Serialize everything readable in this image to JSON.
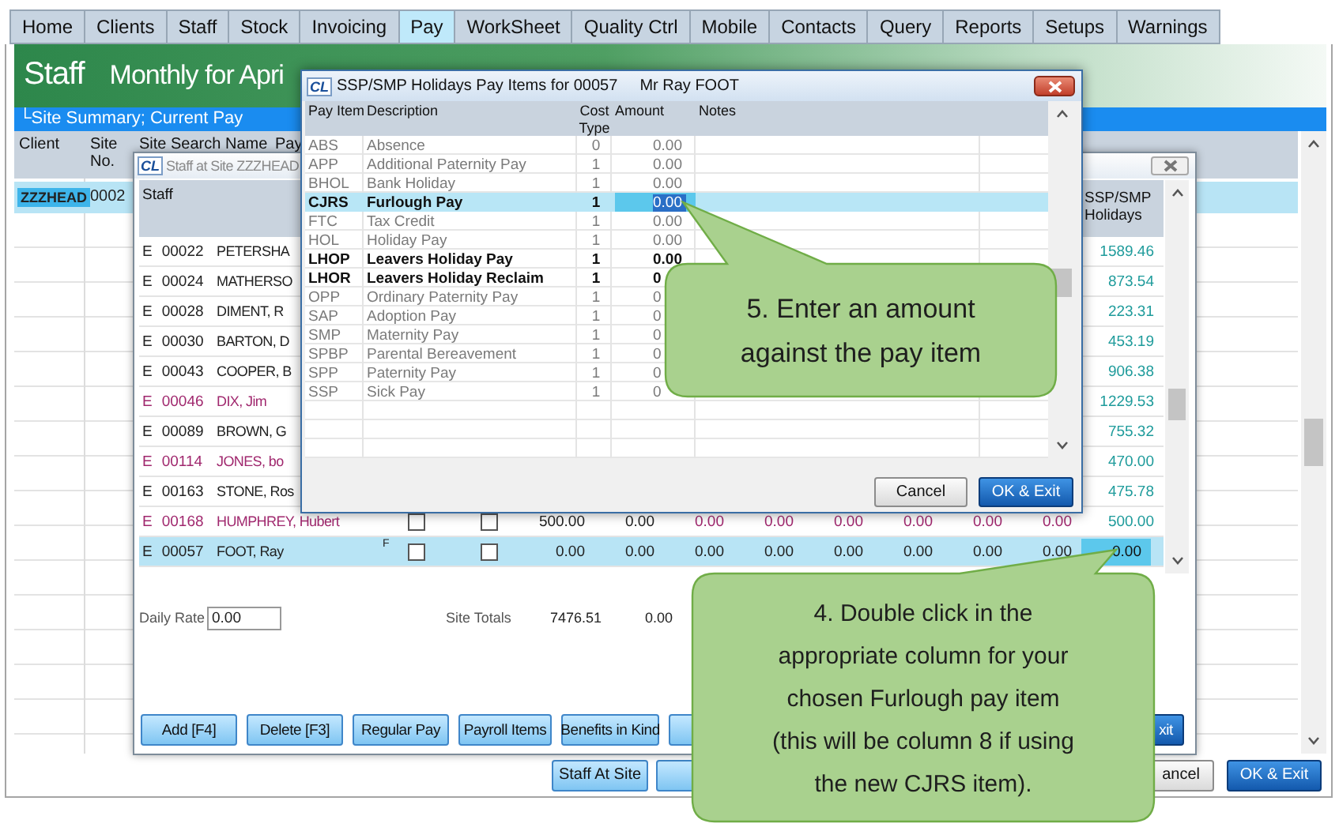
{
  "tabs": [
    {
      "label": "Home",
      "selected": false
    },
    {
      "label": "Clients",
      "selected": false
    },
    {
      "label": "Staff",
      "selected": false
    },
    {
      "label": "Stock",
      "selected": false
    },
    {
      "label": "Invoicing",
      "selected": false
    },
    {
      "label": "Pay",
      "selected": true
    },
    {
      "label": "WorkSheet",
      "selected": false
    },
    {
      "label": "Quality Ctrl",
      "selected": false
    },
    {
      "label": "Mobile",
      "selected": false
    },
    {
      "label": "Contacts",
      "selected": false
    },
    {
      "label": "Query",
      "selected": false
    },
    {
      "label": "Reports",
      "selected": false
    },
    {
      "label": "Setups",
      "selected": false
    },
    {
      "label": "Warnings",
      "selected": false
    }
  ],
  "header": {
    "title": "Staff",
    "subtitle": "Monthly for Apri"
  },
  "breadcrumb": "└Site Summary; Current Pay",
  "main_table": {
    "columns": [
      "Client",
      "Site No.",
      "Site Search Name",
      "Pay"
    ],
    "rows": [
      {
        "client": "ZZZHEAD",
        "site_no": "0002",
        "selected": true
      }
    ]
  },
  "main_buttons": [
    {
      "label": "Staff At Site",
      "kind": "light"
    },
    {
      "kind": "blank"
    },
    {
      "label": "ancel",
      "kind": "plain"
    },
    {
      "label": "OK & Exit",
      "kind": "primary"
    }
  ],
  "staff_window": {
    "logo": "CL",
    "title": "Staff at Site ZZZHEAD",
    "columns": [
      "Staff",
      "SSP/SMP Holidays"
    ],
    "rows": [
      {
        "type": "E",
        "code": "00022",
        "name": "PETERSHA",
        "color": "#222222",
        "holidays": "1589.46",
        "selected": false
      },
      {
        "type": "E",
        "code": "00024",
        "name": "MATHERSO",
        "color": "#222222",
        "holidays": "873.54",
        "selected": false
      },
      {
        "type": "E",
        "code": "00028",
        "name": "DIMENT, R",
        "color": "#222222",
        "holidays": "223.31",
        "selected": false
      },
      {
        "type": "E",
        "code": "00030",
        "name": "BARTON, D",
        "color": "#222222",
        "holidays": "453.19",
        "selected": false
      },
      {
        "type": "E",
        "code": "00043",
        "name": "COOPER, B",
        "color": "#222222",
        "holidays": "906.38",
        "selected": false
      },
      {
        "type": "E",
        "code": "00046",
        "name": "DIX, Jim",
        "color": "#a0286e",
        "holidays": "1229.53",
        "selected": false
      },
      {
        "type": "E",
        "code": "00089",
        "name": "BROWN, G",
        "color": "#222222",
        "holidays": "755.32",
        "selected": false
      },
      {
        "type": "E",
        "code": "00114",
        "name": "JONES, bo",
        "color": "#a0286e",
        "holidays": "470.00",
        "selected": false
      },
      {
        "type": "E",
        "code": "00163",
        "name": "STONE, Ros",
        "color": "#222222",
        "holidays": "475.78",
        "selected": false
      },
      {
        "type": "E",
        "code": "00168",
        "name": "HUMPHREY, Hubert",
        "color": "#a0286e",
        "holidays": "500.00",
        "selected": false,
        "checks": [
          false,
          false
        ],
        "values": [
          {
            "text": "500.00",
            "color": "#222222"
          },
          {
            "text": "0.00",
            "color": "#222222"
          },
          {
            "text": "0.00",
            "color": "#a0286e"
          },
          {
            "text": "0.00",
            "color": "#a0286e"
          },
          {
            "text": "0.00",
            "color": "#a0286e"
          },
          {
            "text": "0.00",
            "color": "#a0286e"
          },
          {
            "text": "0.00",
            "color": "#a0286e"
          },
          {
            "text": "0.00",
            "color": "#a0286e"
          }
        ]
      },
      {
        "type": "E",
        "code": "00057",
        "name": "FOOT, Ray",
        "color": "#222222",
        "holidays": "0.00",
        "selected": true,
        "flag": "F",
        "checks": [
          false,
          false
        ],
        "values": [
          {
            "text": "0.00",
            "color": "#222222"
          },
          {
            "text": "0.00",
            "color": "#222222"
          },
          {
            "text": "0.00",
            "color": "#222222"
          },
          {
            "text": "0.00",
            "color": "#222222"
          },
          {
            "text": "0.00",
            "color": "#222222"
          },
          {
            "text": "0.00",
            "color": "#222222"
          },
          {
            "text": "0.00",
            "color": "#222222"
          },
          {
            "text": "0.00",
            "color": "#222222"
          }
        ]
      }
    ],
    "daily_rate_label": "Daily Rate",
    "daily_rate": "0.00",
    "totals_label": "Site Totals",
    "totals": [
      "7476.51",
      "0.00"
    ],
    "buttons": [
      {
        "label": "Add [F4]",
        "kind": "light"
      },
      {
        "label": "Delete [F3]",
        "kind": "light"
      },
      {
        "label": "Regular Pay",
        "kind": "light"
      },
      {
        "label": "Payroll Items",
        "kind": "light"
      },
      {
        "label": "Benefits in Kind",
        "kind": "light"
      },
      {
        "kind": "blank"
      },
      {
        "label": "xit",
        "kind": "primary"
      }
    ]
  },
  "dialog": {
    "logo": "CL",
    "title": "SSP/SMP Holidays Pay Items for 00057",
    "person": "Mr Ray FOOT",
    "columns": [
      "Pay Item",
      "Description",
      "Cost Type",
      "Amount",
      "Notes"
    ],
    "rows": [
      {
        "code": "ABS",
        "description": "Absence",
        "cost_type": "0",
        "amount": "0.00",
        "bold": false,
        "selected": false
      },
      {
        "code": "APP",
        "description": "Additional Paternity Pay",
        "cost_type": "1",
        "amount": "0.00",
        "bold": false,
        "selected": false
      },
      {
        "code": "BHOL",
        "description": "Bank Holiday",
        "cost_type": "1",
        "amount": "0.00",
        "bold": false,
        "selected": false
      },
      {
        "code": "CJRS",
        "description": "Furlough Pay",
        "cost_type": "1",
        "amount": "0.00",
        "bold": true,
        "selected": true
      },
      {
        "code": "FTC",
        "description": "Tax Credit",
        "cost_type": "1",
        "amount": "0.00",
        "bold": false,
        "selected": false
      },
      {
        "code": "HOL",
        "description": "Holiday Pay",
        "cost_type": "1",
        "amount": "0.00",
        "bold": false,
        "selected": false
      },
      {
        "code": "LHOP",
        "description": "Leavers Holiday Pay",
        "cost_type": "1",
        "amount": "0.00",
        "bold": true,
        "selected": false
      },
      {
        "code": "LHOR",
        "description": "Leavers Holiday Reclaim",
        "cost_type": "1",
        "amount": "0",
        "bold": true,
        "selected": false
      },
      {
        "code": "OPP",
        "description": "Ordinary Paternity Pay",
        "cost_type": "1",
        "amount": "0",
        "bold": false,
        "selected": false
      },
      {
        "code": "SAP",
        "description": "Adoption Pay",
        "cost_type": "1",
        "amount": "0",
        "bold": false,
        "selected": false
      },
      {
        "code": "SMP",
        "description": "Maternity Pay",
        "cost_type": "1",
        "amount": "0",
        "bold": false,
        "selected": false
      },
      {
        "code": "SPBP",
        "description": "Parental Bereavement",
        "cost_type": "1",
        "amount": "0",
        "bold": false,
        "selected": false
      },
      {
        "code": "SPP",
        "description": "Paternity Pay",
        "cost_type": "1",
        "amount": "0",
        "bold": false,
        "selected": false
      },
      {
        "code": "SSP",
        "description": "Sick Pay",
        "cost_type": "1",
        "amount": "0",
        "bold": false,
        "selected": false
      }
    ],
    "buttons": [
      {
        "label": "Cancel",
        "kind": "plain"
      },
      {
        "label": "OK & Exit",
        "kind": "primary"
      }
    ]
  },
  "callouts": [
    {
      "text": "5. Enter an amount\nagainst the pay item"
    },
    {
      "text": "4. Double click in the\nappropriate column for your\nchosen Furlough pay item\n(this will be column 8 if using\nthe new CJRS item)."
    }
  ]
}
